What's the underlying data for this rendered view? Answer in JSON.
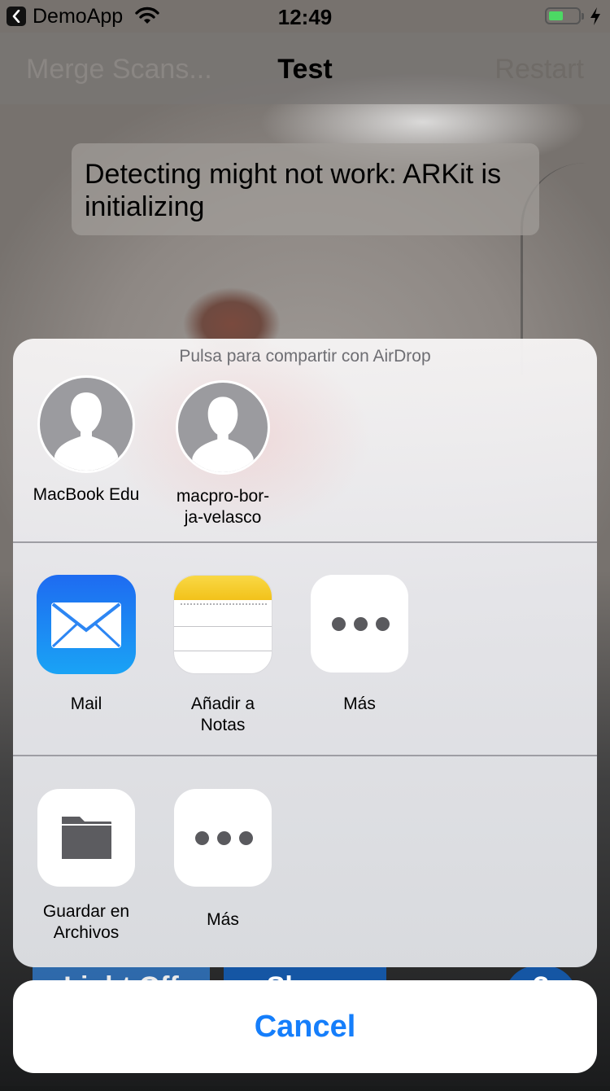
{
  "status_bar": {
    "back_app": "DemoApp",
    "time": "12:49",
    "back_icon": "chevron-left-icon",
    "wifi_icon": "wifi-icon",
    "battery_icon": "battery-icon",
    "charging_icon": "bolt-icon",
    "battery_level": 0.5,
    "battery_color": "#4cd964"
  },
  "nav_bar": {
    "left_button": "Merge Scans...",
    "title": "Test",
    "right_button": "Restart"
  },
  "toast": {
    "message": "Detecting might not work: ARKit is initializing"
  },
  "behind_buttons": {
    "light": "Light Off",
    "share": "Share",
    "help": "?"
  },
  "share_sheet": {
    "airdrop_hint": "Pulsa para compartir con AirDrop",
    "airdrop_contacts": [
      {
        "name": "MacBook Edu",
        "icon": "person-silhouette-icon"
      },
      {
        "name": "macpro-bor-ja-velasco",
        "icon": "person-silhouette-icon"
      }
    ],
    "share_actions": [
      {
        "label": "Mail",
        "icon": "mail-icon"
      },
      {
        "label": "Añadir a Notas",
        "icon": "notes-icon"
      },
      {
        "label": "Más",
        "icon": "more-icon"
      }
    ],
    "other_actions": [
      {
        "label": "Guardar en Archivos",
        "icon": "folder-icon"
      },
      {
        "label": "Más",
        "icon": "more-icon"
      }
    ],
    "cancel_label": "Cancel"
  },
  "colors": {
    "accent": "#157efb",
    "mail_gradient_top": "#1e6bf1",
    "mail_gradient_bottom": "#1aa3f5",
    "notes_yellow": "#f2c21a"
  }
}
